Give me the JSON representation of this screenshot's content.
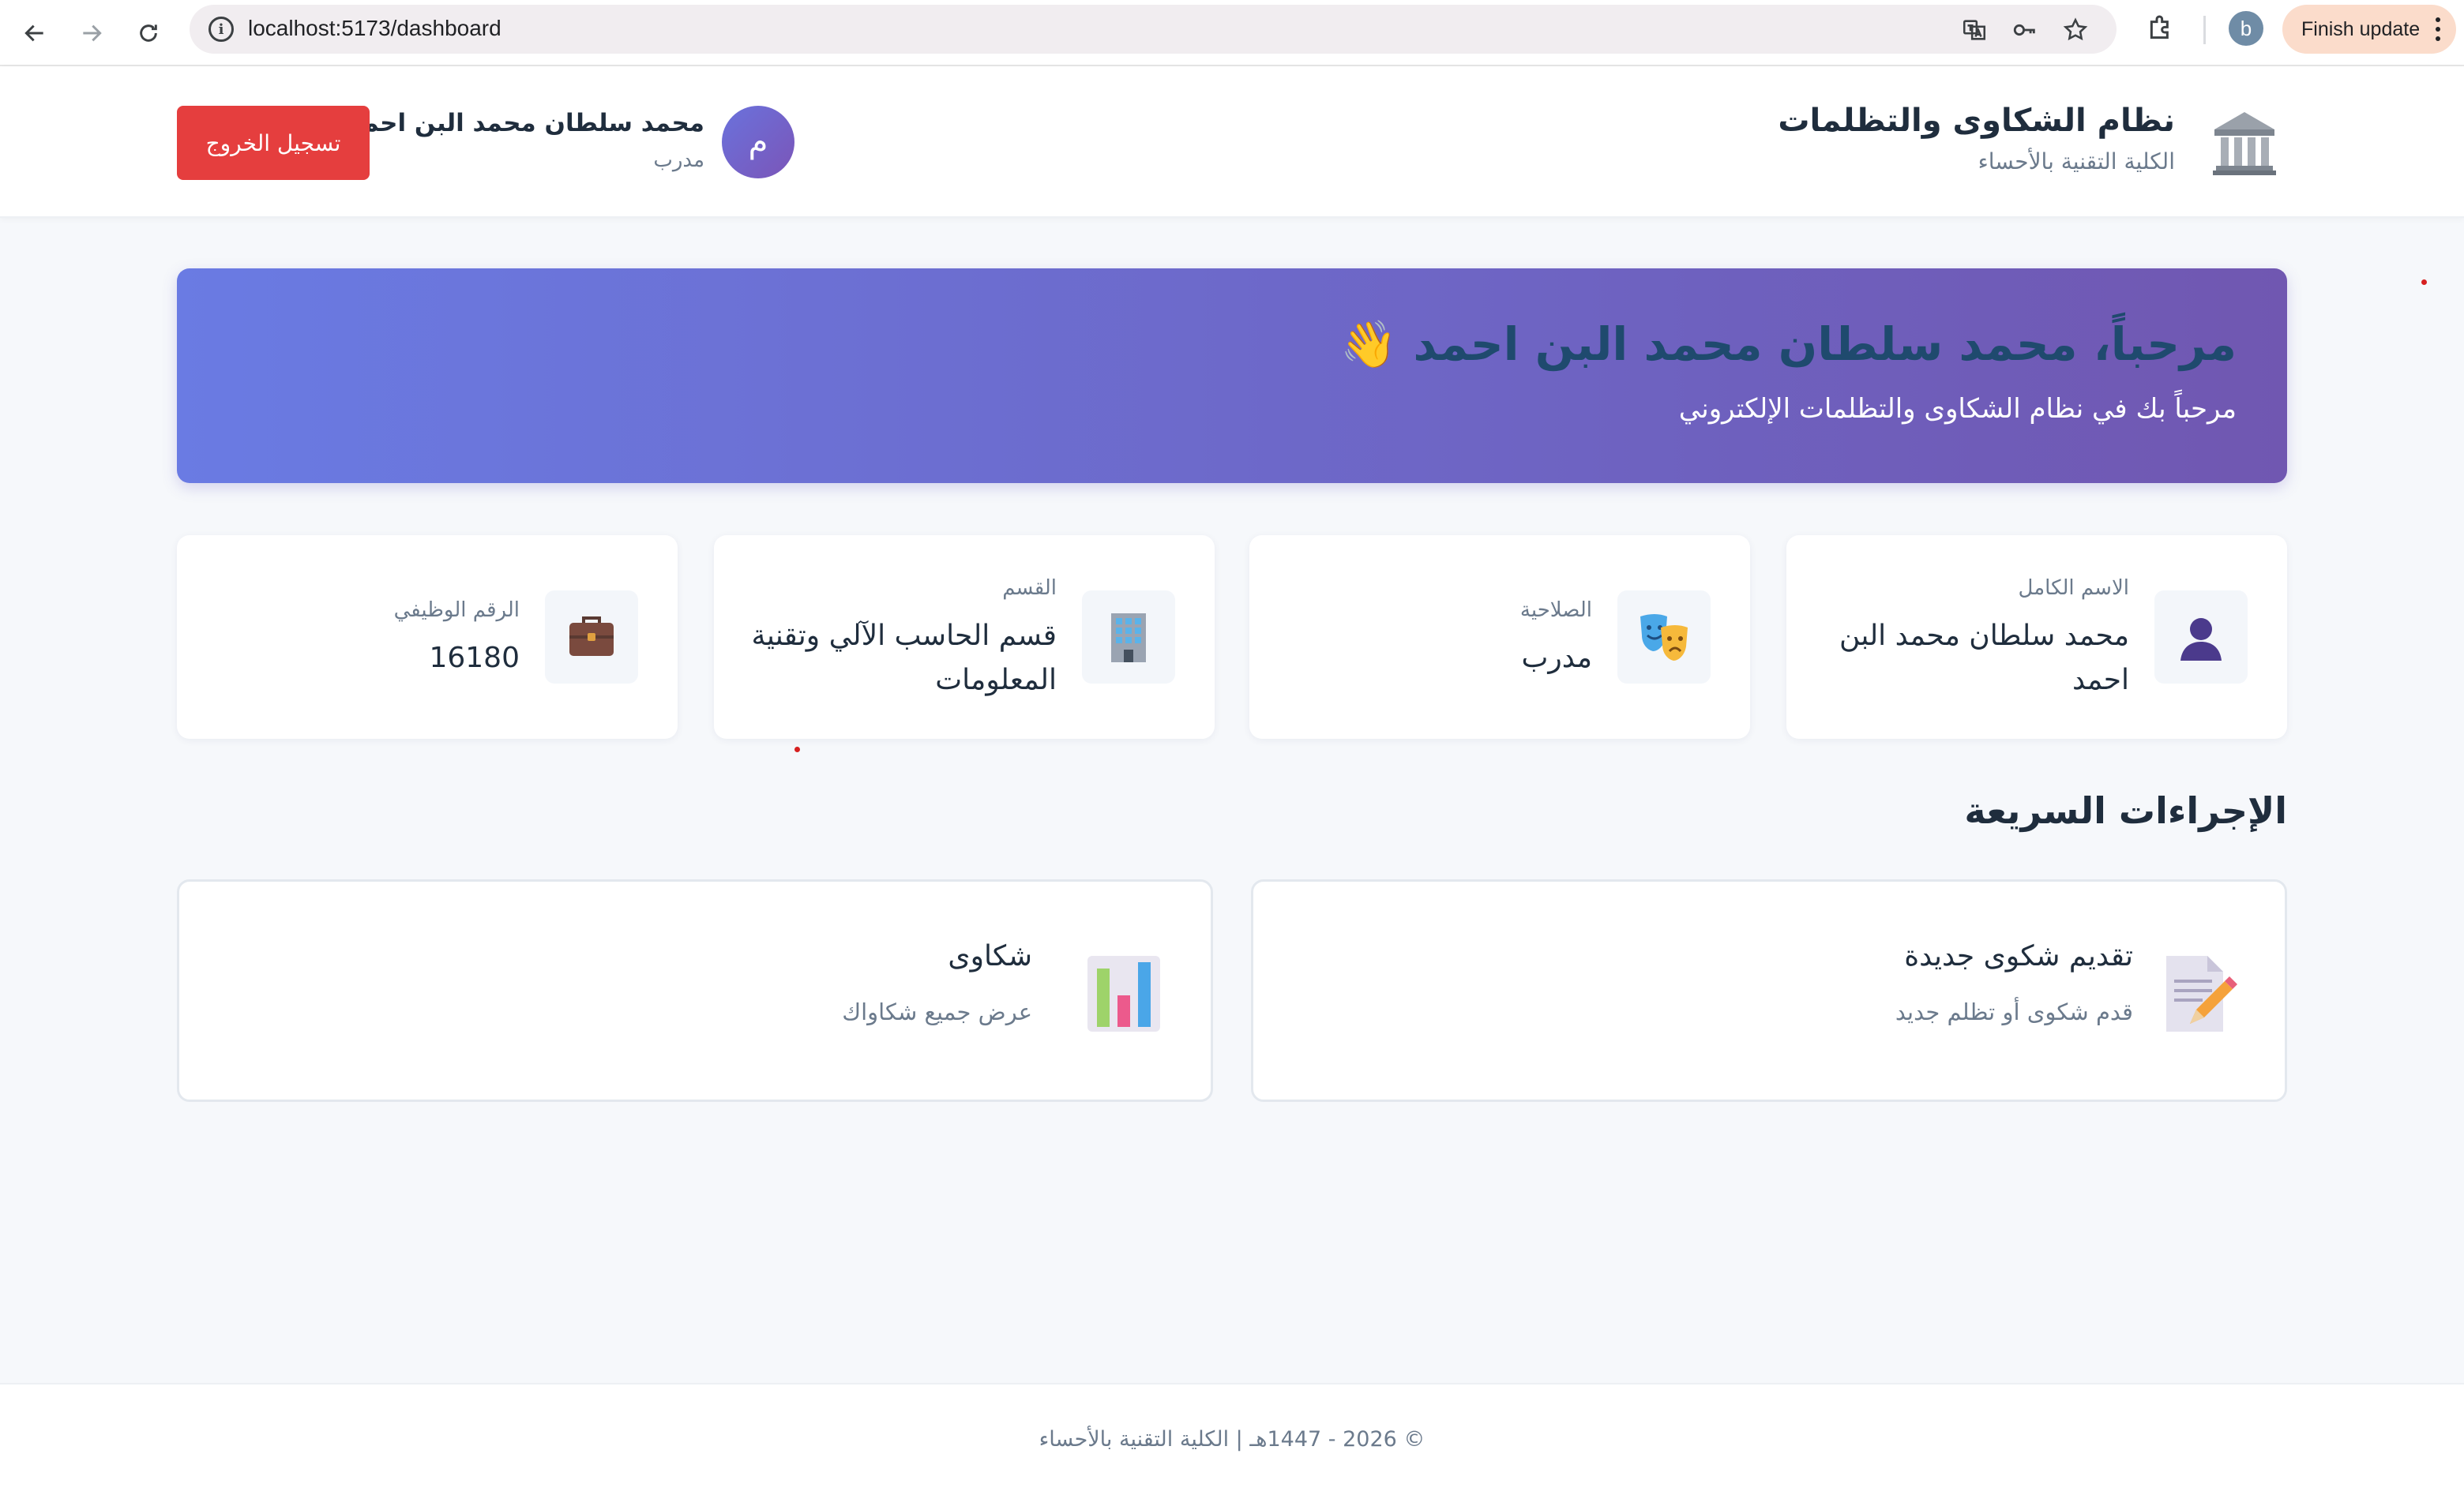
{
  "browser": {
    "url": "localhost:5173/dashboard",
    "profile_initial": "b",
    "update_label": "Finish update"
  },
  "header": {
    "title": "نظام الشكاوى والتظلمات",
    "subtitle": "الكلية التقنية بالأحساء",
    "user_name": "محمد سلطان محمد البن احمد",
    "user_role": "مدرب",
    "avatar_initial": "م",
    "logout_label": "تسجيل الخروج"
  },
  "banner": {
    "title": "مرحباً، محمد سلطان محمد البن احمد 👋",
    "subtitle": "مرحباً بك في نظام الشكاوى والتظلمات الإلكتروني"
  },
  "info_cards": {
    "full_name": {
      "label": "الاسم الكامل",
      "value": "محمد سلطان محمد البن احمد",
      "icon": "user-icon"
    },
    "role": {
      "label": "الصلاحية",
      "value": "مدرب",
      "icon": "theater-masks-icon"
    },
    "department": {
      "label": "القسم",
      "value": "قسم الحاسب الآلي وتقنية المعلومات",
      "icon": "office-building-icon"
    },
    "employee_id": {
      "label": "الرقم الوظيفي",
      "value": "16180",
      "icon": "briefcase-icon"
    }
  },
  "quick_actions": {
    "title": "الإجراءات السريعة",
    "new_complaint": {
      "title": "تقديم شكوى جديدة",
      "description": "قدم شكوى أو تظلم جديد",
      "icon": "memo-pencil-icon"
    },
    "complaints": {
      "title": "شكاوى",
      "description": "عرض جميع شكاواك",
      "icon": "bar-chart-icon"
    }
  },
  "footer": {
    "text": "© 2026 - 1447هـ | الكلية التقنية بالأحساء"
  },
  "colors": {
    "accent_gradient_start": "#6a7be3",
    "accent_gradient_end": "#7057b1",
    "logout": "#e53e3e",
    "background": "#f6f8fb"
  }
}
